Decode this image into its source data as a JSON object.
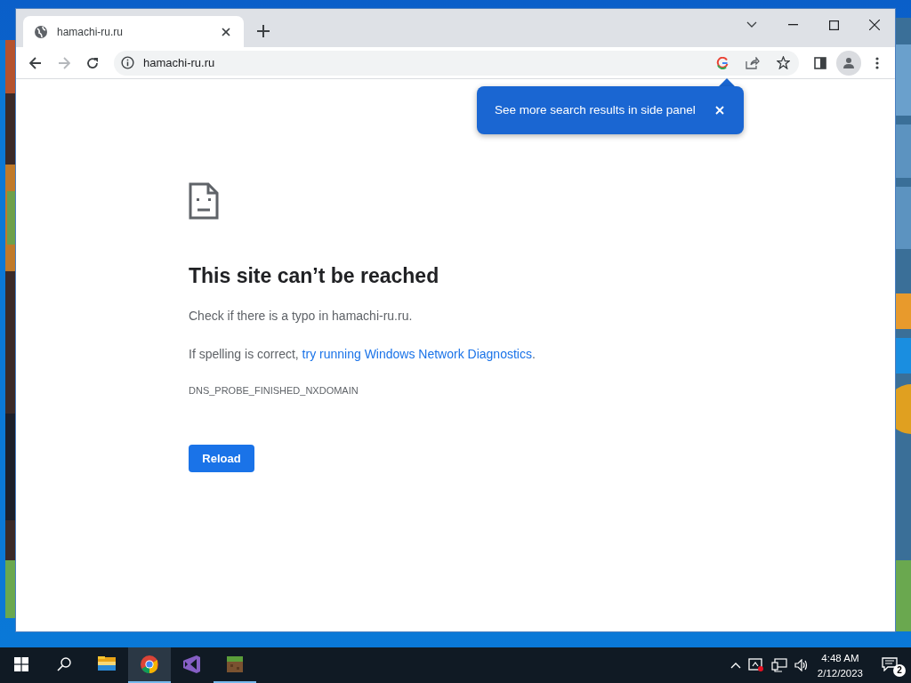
{
  "browser": {
    "tab": {
      "title": "hamachi-ru.ru",
      "selected": true
    },
    "address": "hamachi-ru.ru",
    "popup": {
      "text": "See more search results in side panel"
    },
    "error": {
      "title": "This site can’t be reached",
      "line1": "Check if there is a typo in hamachi-ru.ru.",
      "line2_prefix": "If spelling is correct, ",
      "line2_link": "try running Windows Network Diagnostics",
      "line2_suffix": ".",
      "code": "DNS_PROBE_FINISHED_NXDOMAIN",
      "button": "Reload"
    }
  },
  "taskbar": {
    "apps": [
      {
        "kind": "explorer",
        "selected": false,
        "running": false
      },
      {
        "kind": "chrome",
        "selected": true,
        "running": true
      },
      {
        "kind": "studio",
        "selected": false,
        "running": false
      },
      {
        "kind": "block",
        "selected": false,
        "running": true
      }
    ],
    "time": "4:48 AM",
    "date": "2/12/2023",
    "notifications": "2"
  }
}
